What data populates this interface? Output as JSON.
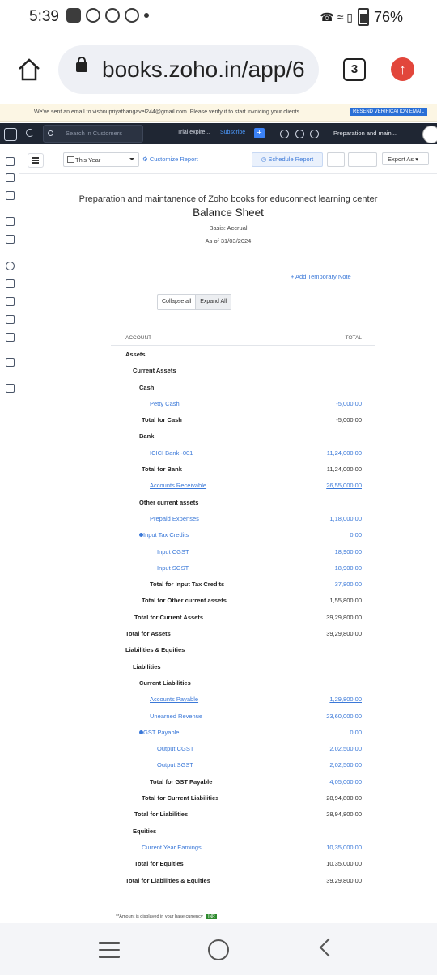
{
  "status": {
    "time": "5:39",
    "battery": "76%"
  },
  "browser": {
    "url": "books.zoho.in/app/6",
    "tab_count": "3"
  },
  "notice": {
    "message": "We've sent an email to vishnupriyathangavel244@gmail.com. Please verify it to start invoicing your clients.",
    "button": "RESEND VERIFICATION EMAIL"
  },
  "topnav": {
    "search_placeholder": "Search in Customers",
    "trial": "Trial expire...",
    "subscribe": "Subscribe",
    "org": "Preparation and main..."
  },
  "toolbar": {
    "period": "This Year",
    "customize": "Customize Report",
    "schedule": "Schedule Report",
    "export": "Export As"
  },
  "report": {
    "org_name": "Preparation and maintanence of Zoho books for educonnect learning center",
    "title": "Balance Sheet",
    "basis": "Basis: Accrual",
    "as_of": "As of 31/03/2024",
    "add_note": "+ Add Temporary Note",
    "collapse_all": "Collapse all",
    "expand_all": "Expand All",
    "col_account": "ACCOUNT",
    "col_total": "TOTAL",
    "rows": [
      {
        "label": "Assets",
        "value": ""
      },
      {
        "label": "Current Assets",
        "value": ""
      },
      {
        "label": "Cash",
        "value": ""
      },
      {
        "label": "Petty Cash",
        "value": "-5,000.00"
      },
      {
        "label": "Total for Cash",
        "value": "-5,000.00"
      },
      {
        "label": "Bank",
        "value": ""
      },
      {
        "label": "ICICI Bank -001",
        "value": "11,24,000.00"
      },
      {
        "label": "Total for Bank",
        "value": "11,24,000.00"
      },
      {
        "label": "Accounts Receivable",
        "value": "26,55,000.00"
      },
      {
        "label": "Other current assets",
        "value": ""
      },
      {
        "label": "Prepaid Expenses",
        "value": "1,18,000.00"
      },
      {
        "label": "Input Tax Credits",
        "value": "0.00"
      },
      {
        "label": "Input CGST",
        "value": "18,900.00"
      },
      {
        "label": "Input SGST",
        "value": "18,900.00"
      },
      {
        "label": "Total for Input Tax Credits",
        "value": "37,800.00"
      },
      {
        "label": "Total for Other current assets",
        "value": "1,55,800.00"
      },
      {
        "label": "Total for Current Assets",
        "value": "39,29,800.00"
      },
      {
        "label": "Total for Assets",
        "value": "39,29,800.00"
      },
      {
        "label": "Liabilities & Equities",
        "value": ""
      },
      {
        "label": "Liabilities",
        "value": ""
      },
      {
        "label": "Current Liabilities",
        "value": ""
      },
      {
        "label": "Accounts Payable",
        "value": "1,29,800.00"
      },
      {
        "label": "Unearned Revenue",
        "value": "23,60,000.00"
      },
      {
        "label": "GST Payable",
        "value": "0.00"
      },
      {
        "label": "Output CGST",
        "value": "2,02,500.00"
      },
      {
        "label": "Output SGST",
        "value": "2,02,500.00"
      },
      {
        "label": "Total for GST Payable",
        "value": "4,05,000.00"
      },
      {
        "label": "Total for Current Liabilities",
        "value": "28,94,800.00"
      },
      {
        "label": "Total for Liabilities",
        "value": "28,94,800.00"
      },
      {
        "label": "Equities",
        "value": ""
      },
      {
        "label": "Current Year Earnings",
        "value": "10,35,000.00"
      },
      {
        "label": "Total for Equities",
        "value": "10,35,000.00"
      },
      {
        "label": "Total for Liabilities & Equities",
        "value": "39,29,800.00"
      }
    ],
    "footnote": "**Amount is displayed in your base currency",
    "currency": "INR"
  },
  "colors": {
    "accent": "#3a78d8",
    "nav_bg": "#1f2633",
    "notice_bg": "#fcf6e4"
  }
}
